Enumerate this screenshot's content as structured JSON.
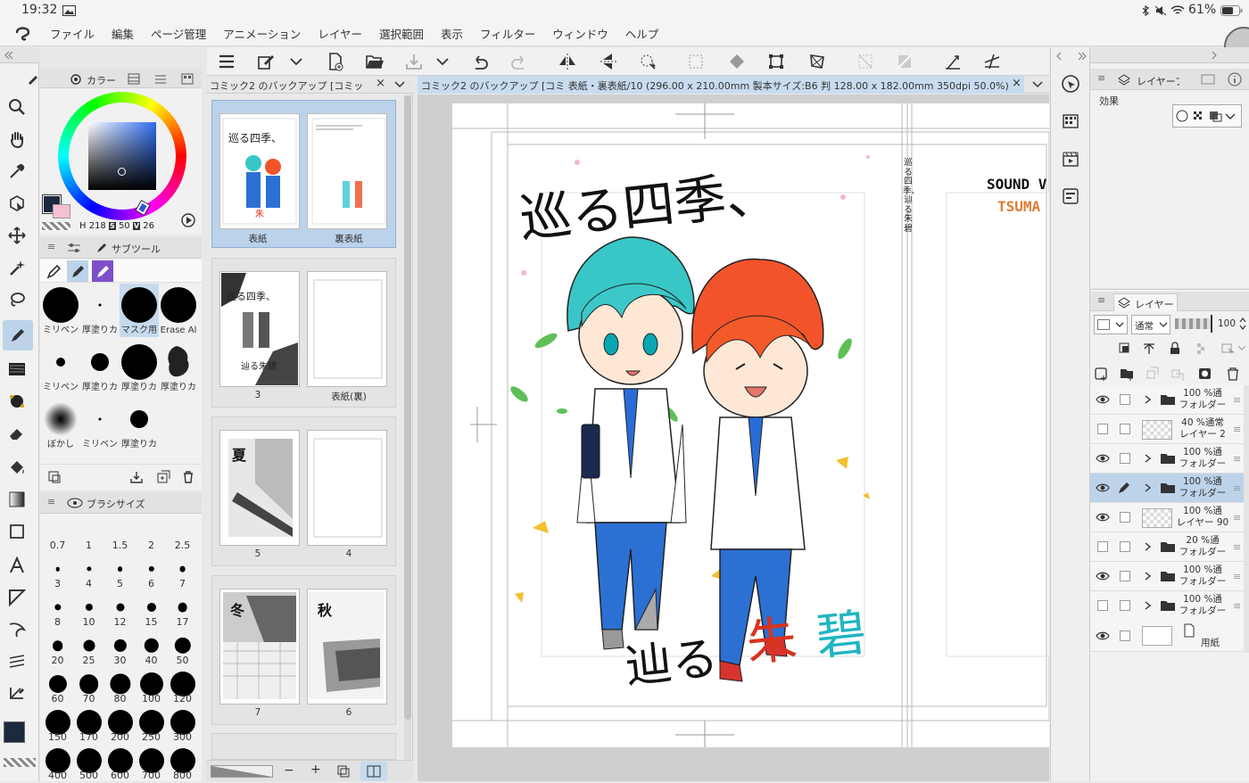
{
  "status": {
    "time": "19:32",
    "battery": "61%"
  },
  "menu": [
    "ファイル",
    "編集",
    "ページ管理",
    "アニメーション",
    "レイヤー",
    "選択範囲",
    "表示",
    "フィルター",
    "ウィンドウ",
    "ヘルプ"
  ],
  "color_panel": {
    "tab": "カラー",
    "h": "218",
    "s": "50",
    "v": "26",
    "main_color": "#1c2a3e",
    "sub_color": "#f5c0d2"
  },
  "subtool": {
    "tab": "サブツール",
    "brushes": [
      {
        "label": "ミリペン",
        "size": 40
      },
      {
        "label": "厚塗りカ",
        "size": 3
      },
      {
        "label": "マスク用",
        "size": 40
      },
      {
        "label": "Erase Al",
        "size": 40
      },
      {
        "label": "ミリペン",
        "size": 10
      },
      {
        "label": "厚塗りカ",
        "size": 20
      },
      {
        "label": "厚塗りカ",
        "size": 40
      },
      {
        "label": "厚塗りカ",
        "size": 36
      },
      {
        "label": "ぼかし",
        "size": 36
      },
      {
        "label": "ミリペン",
        "size": 3
      },
      {
        "label": "厚塗りカ",
        "size": 20
      }
    ]
  },
  "brush_size": {
    "tab": "ブラシサイズ",
    "sizes": [
      "0.7",
      "1",
      "1.5",
      "2",
      "2.5",
      "3",
      "4",
      "5",
      "6",
      "7",
      "8",
      "10",
      "12",
      "15",
      "17",
      "20",
      "25",
      "30",
      "40",
      "50",
      "60",
      "70",
      "80",
      "100",
      "120",
      "150",
      "170",
      "200",
      "250",
      "300",
      "400",
      "500",
      "600",
      "700",
      "800"
    ]
  },
  "tabs": {
    "page_tab": "コミック2 のバックアップ [コミッ",
    "canvas_tab": "コミック2 のバックアップ [コミ 表紙・裏表紙/10 (296.00 x 210.00mm 製本サイズ:B6 判 128.00 x 182.00mm 350dpi 50.0%)"
  },
  "pages": [
    {
      "left": "表紙",
      "right": "裏表紙"
    },
    {
      "left": "3",
      "right": "表紙(裏)"
    },
    {
      "left": "5",
      "right": "4"
    },
    {
      "left": "7",
      "right": "6"
    }
  ],
  "thumb_text": {
    "p3_title": "巡る四季、",
    "p3_sub": "辿る朱碧",
    "p5_kanji": "夏",
    "p7_kanji": "冬",
    "p6_kanji": "秋"
  },
  "cover": {
    "title1": "巡る四季、",
    "title2a": "辿る",
    "title2b": "朱",
    "title2c": "碧",
    "spine": "巡る四季、辿る朱碧",
    "back1": "SOUND V",
    "back2": "TSUMA"
  },
  "right_panels": {
    "layer_property_tab": "レイヤープロ",
    "effect_label": "効果",
    "layer_tab": "レイヤー",
    "blend_mode": "通常",
    "opacity": "100"
  },
  "layers": [
    {
      "l1": "100 %通",
      "l2": "フォルダー",
      "visible": true,
      "folder": true,
      "selected": false
    },
    {
      "l1": "40 %通常",
      "l2": "レイヤー 2",
      "visible": false,
      "folder": false,
      "selected": false
    },
    {
      "l1": "100 %通",
      "l2": "フォルダー",
      "visible": true,
      "folder": true,
      "selected": false
    },
    {
      "l1": "100 %通",
      "l2": "フォルダー",
      "visible": true,
      "folder": true,
      "selected": true
    },
    {
      "l1": "100 %通",
      "l2": "レイヤー 90",
      "visible": true,
      "folder": false,
      "selected": false
    },
    {
      "l1": "20 %通",
      "l2": "フォルダー",
      "visible": false,
      "folder": true,
      "selected": false
    },
    {
      "l1": "100 %通",
      "l2": "フォルダー",
      "visible": true,
      "folder": true,
      "selected": false
    },
    {
      "l1": "100 %通",
      "l2": "フォルダー",
      "visible": false,
      "folder": true,
      "selected": false
    }
  ],
  "paper_layer": "用紙"
}
